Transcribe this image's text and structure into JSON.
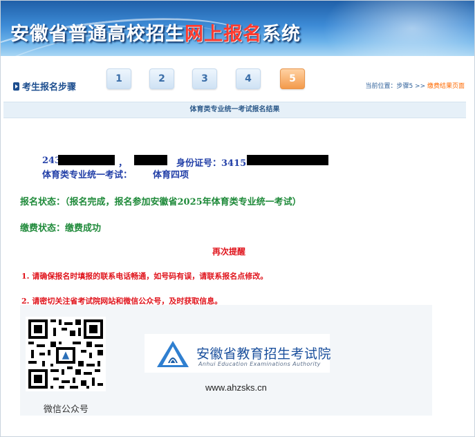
{
  "banner": {
    "title_part1": "安徽省普通高校招生",
    "title_highlight": "网上报名",
    "title_part2": "系统"
  },
  "steps": {
    "label": "考生报名步骤",
    "items": [
      "1",
      "2",
      "3",
      "4",
      "5"
    ],
    "active": "5"
  },
  "location": {
    "prefix": "当前位置：步骤5 >> ",
    "current": "缴费结果页面"
  },
  "section_title": "体育类专业统一考试报名结果",
  "candidate": {
    "num_prefix": "243",
    "comma": "，",
    "id_label": "身份证号：3415",
    "exam_label": "体育类专业统一考试：",
    "exam_value": "体育四项"
  },
  "status": {
    "registration": "报名状态：（报名完成，报名参加安徽省2025年体育类专业统一考试）",
    "payment": "缴费状态：缴费成功"
  },
  "reminder": {
    "title": "再次提醒",
    "items": [
      "1.  请确保报名时填报的联系电话畅通，如号码有误，请联系报名点修改。",
      "2.  请密切关注省考试院网站和微信公众号，及时获取信息。"
    ]
  },
  "footer": {
    "qr_caption": "微信公众号",
    "logo_cn": "安徽省教育招生考试院",
    "logo_en": "Anhui Education Examinations Authority",
    "website": "www.ahzsks.cn"
  },
  "colors": {
    "banner_blue": "#1f5fa8",
    "highlight_red": "#ff3b2f",
    "text_blue": "#2340a8",
    "text_green": "#1f8a3a",
    "text_red": "#e0141c",
    "active_step": "#f39a4b"
  }
}
